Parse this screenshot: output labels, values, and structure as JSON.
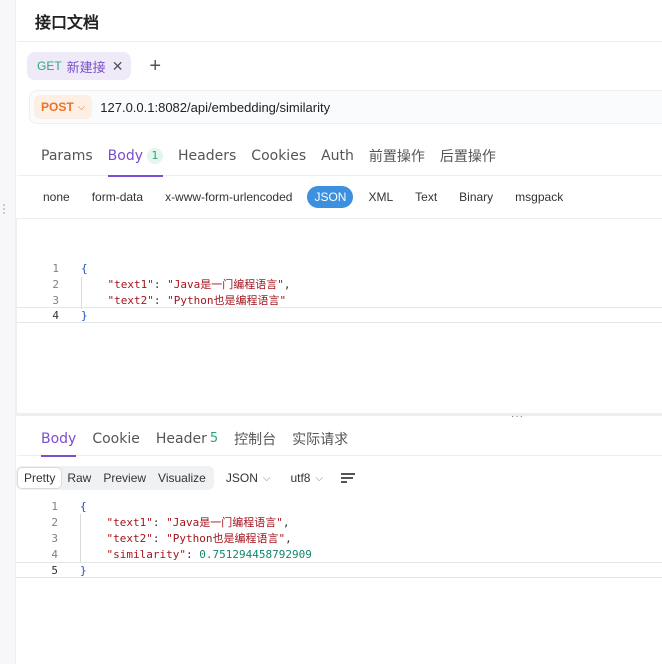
{
  "header": {
    "title": "接口文档"
  },
  "request_tab": {
    "method": "GET",
    "name": "新建接",
    "close": "✕"
  },
  "add_tab": "+",
  "request": {
    "method": "POST",
    "url": "127.0.0.1:8082/api/embedding/similarity"
  },
  "request_tabs": [
    {
      "label": "Params"
    },
    {
      "label": "Body",
      "badge": "1"
    },
    {
      "label": "Headers"
    },
    {
      "label": "Cookies"
    },
    {
      "label": "Auth"
    },
    {
      "label": "前置操作"
    },
    {
      "label": "后置操作"
    }
  ],
  "body_types": [
    "none",
    "form-data",
    "x-www-form-urlencoded",
    "JSON",
    "XML",
    "Text",
    "Binary",
    "msgpack"
  ],
  "request_body": {
    "line_numbers": [
      "1",
      "2",
      "3",
      "4"
    ],
    "open": "{",
    "close": "}",
    "fields": [
      {
        "key": "\"text1\"",
        "value": "\"Java是一门编程语言\"",
        "sep": ": ",
        "trail": ","
      },
      {
        "key": "\"text2\"",
        "value": "\"Python也是编程语言\"",
        "sep": ": ",
        "trail": ""
      }
    ]
  },
  "divider_handle": "···",
  "response_tabs": [
    {
      "label": "Body"
    },
    {
      "label": "Cookie"
    },
    {
      "label": "Header",
      "count": "5"
    },
    {
      "label": "控制台"
    },
    {
      "label": "实际请求"
    }
  ],
  "view_modes": [
    "Pretty",
    "Raw",
    "Preview",
    "Visualize"
  ],
  "format_select": "JSON",
  "encoding_select": "utf8",
  "response_body": {
    "line_numbers": [
      "1",
      "2",
      "3",
      "4",
      "5"
    ],
    "open": "{",
    "close": "}",
    "fields": [
      {
        "key": "\"text1\"",
        "value": "\"Java是一门编程语言\"",
        "sep": ": ",
        "trail": ","
      },
      {
        "key": "\"text2\"",
        "value": "\"Python也是编程语言\"",
        "sep": ": ",
        "trail": ","
      },
      {
        "key": "\"similarity\"",
        "value": "0.751294458792909",
        "sep": ": ",
        "trail": ""
      }
    ]
  },
  "colors": {
    "accent": "#7c4dcc",
    "json_active": "#3d8fe0",
    "post": "#e8742b",
    "get": "#2aa876"
  }
}
